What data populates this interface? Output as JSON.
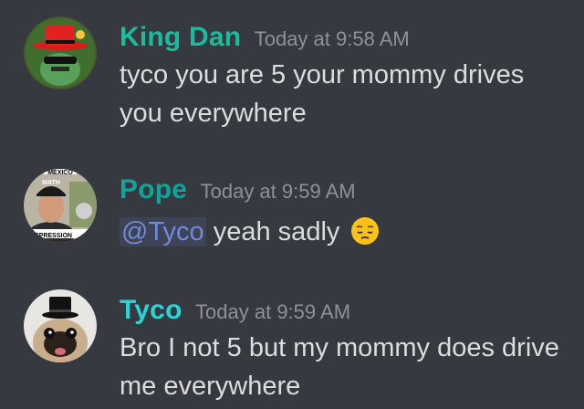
{
  "messages": [
    {
      "username": "King Dan",
      "username_color": "#1abc9c",
      "timestamp": "Today at 9:58 AM",
      "text": "tyco you are 5 your mommy drives you everywhere",
      "avatar_icon": "red-top-hat-character-avatar"
    },
    {
      "username": "Pope",
      "username_color": "#11a49a",
      "timestamp": "Today at 9:59 AM",
      "mention": "@Tyco",
      "text": " yeah sadly",
      "emoji": "pensive-face-emoji",
      "avatar_icon": "photo-avatar",
      "avatar_texts": [
        "MEXICO",
        "MATH",
        "DEPRESSION"
      ]
    },
    {
      "username": "Tyco",
      "username_color": "#2ad4d4",
      "timestamp": "Today at 9:59 AM",
      "text": "Bro I not 5 but my mommy does drive me everywhere",
      "avatar_icon": "pug-top-hat-avatar"
    }
  ]
}
